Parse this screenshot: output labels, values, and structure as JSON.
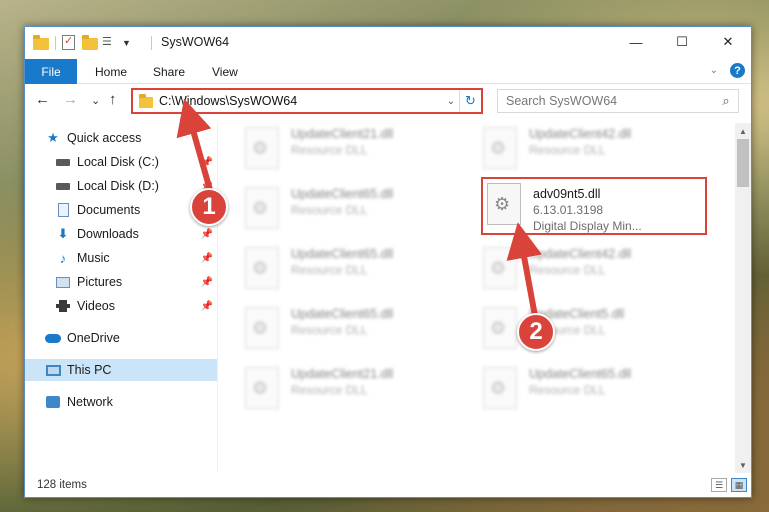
{
  "window": {
    "title": "SysWOW64",
    "controls": {
      "minimize": "—",
      "maximize": "☐",
      "close": "✕"
    }
  },
  "ribbon": {
    "tabs": [
      "File",
      "Home",
      "Share",
      "View"
    ]
  },
  "navigation": {
    "back": "←",
    "forward": "→",
    "recent": "⌄",
    "up": "↑",
    "address": "C:\\Windows\\SysWOW64",
    "search_placeholder": "Search SysWOW64"
  },
  "sidebar": {
    "items": [
      {
        "label": "Quick access",
        "icon": "star-icon"
      },
      {
        "label": "Local Disk (C:)",
        "icon": "disk-icon",
        "pinned": true
      },
      {
        "label": "Local Disk (D:)",
        "icon": "disk-icon",
        "pinned": true
      },
      {
        "label": "Documents",
        "icon": "documents-icon",
        "pinned": true
      },
      {
        "label": "Downloads",
        "icon": "downloads-icon",
        "pinned": true
      },
      {
        "label": "Music",
        "icon": "music-icon",
        "pinned": true
      },
      {
        "label": "Pictures",
        "icon": "pictures-icon",
        "pinned": true
      },
      {
        "label": "Videos",
        "icon": "videos-icon",
        "pinned": true
      },
      {
        "label": "OneDrive",
        "icon": "onedrive-icon"
      },
      {
        "label": "This PC",
        "icon": "this-pc-icon",
        "selected": true
      },
      {
        "label": "Network",
        "icon": "network-icon"
      }
    ]
  },
  "files": [
    {
      "name": "UpdateClient21.dll",
      "sub": "Resource DLL",
      "blurred": true
    },
    {
      "name": "UpdateClient42.dll",
      "sub": "Resource DLL",
      "blurred": true
    },
    {
      "name": "UpdateClient65.dll",
      "sub": "Resource DLL",
      "blurred": true
    },
    {
      "name": "adv09nt5.dll",
      "version": "6.13.01.3198",
      "description": "Digital Display Min...",
      "highlighted": true
    },
    {
      "name": "UpdateClient65.dll",
      "sub": "Resource DLL",
      "blurred": true
    },
    {
      "name": "UpdateClient42.dll",
      "sub": "Resource DLL",
      "blurred": true
    },
    {
      "name": "UpdateClient65.dll",
      "sub": "Resource DLL",
      "blurred": true
    },
    {
      "name": "UpdateClient5.dll",
      "sub": "Resource DLL",
      "blurred": true
    },
    {
      "name": "UpdateClient21.dll",
      "sub": "Resource DLL",
      "blurred": true
    },
    {
      "name": "UpdateClient65.dll",
      "sub": "Resource DLL",
      "blurred": true
    }
  ],
  "status": {
    "item_count": "128 items"
  },
  "callouts": [
    "1",
    "2"
  ],
  "colors": {
    "accent": "#1979ca",
    "highlight": "#d9433a",
    "selection": "#cce4f7"
  }
}
